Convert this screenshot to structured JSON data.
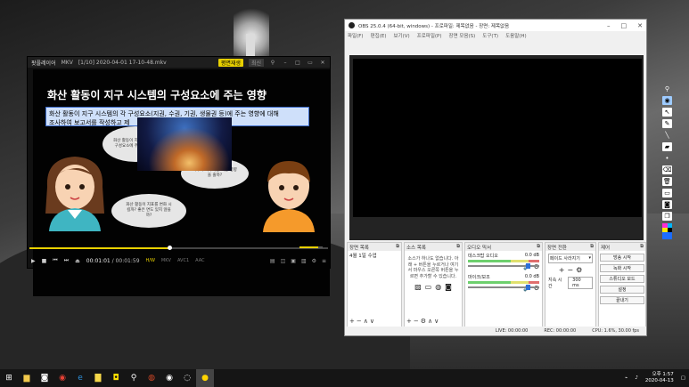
{
  "player": {
    "app_name": "팟플레이어",
    "format": "MKV",
    "file_title": "[1/10] 2020-04-01 17-10-48.mkv",
    "yellow_button": "평면재생",
    "grey_button": "최신",
    "slide_title": "화산 활동이 지구 시스템의 구성요소에 주는 영향",
    "slide_box_line1": "화산 활동이 지구 시스템의 각 구성요소(지권, 수권, 기권, 생물권 등)에 주는 영향에 대해",
    "slide_box_line2": "조사하여 보고서를 작성하고 제",
    "bubble1": "화산 활동이 지구 시스템의 구성요소에 주는 영향은?",
    "bubble2": "지구의 기후에는 어떤 영향을 줄까?",
    "bubble3": "화산 활동이 지표를 변화 시킬까? 좋은 면도 있지 않을까?",
    "time_current": "00:01:01",
    "time_total": "00:01:59",
    "tags": [
      "H/W",
      "MKV",
      "AVC1",
      "AAC"
    ],
    "seek_progress": 0.47,
    "volume": 0.8
  },
  "obs": {
    "title": "OBS 25.0.4 (64-bit, windows) - 프로파일: 제목없음 - 장면: 제목없음",
    "menu": [
      "파일(F)",
      "편집(E)",
      "보기(V)",
      "프로파일(P)",
      "장면 모음(S)",
      "도구(T)",
      "도움말(H)"
    ],
    "scenes_header": "장면 목록",
    "scene_item": "4월 1일 수업",
    "sources_header": "소스 목록",
    "sources_message": "소스가 하나도 없습니다. 아래 + 버튼을 누르거나 여기서 마우스 오른쪽 버튼을 누르면 추가할 수 있습니다.",
    "mixer_header": "오디오 믹서",
    "mixer_rows": [
      {
        "name": "데스크탑 오디오",
        "db": "0.0 dB"
      },
      {
        "name": "마이크/보조",
        "db": "0.0 dB"
      }
    ],
    "transitions_header": "장면 전환",
    "transition_type": "페이드 사라지기",
    "duration_label": "지속 시간",
    "duration_value": "300 ms",
    "controls_header": "제어",
    "controls": [
      "방송 시작",
      "녹화 시작",
      "스튜디오 모드",
      "설정",
      "끝내기"
    ],
    "status_live": "LIVE: 00:00:00",
    "status_rec": "REC: 00:00:00",
    "status_cpu": "CPU: 1.6%, 30.00 fps"
  },
  "taskbar": {
    "time": "오후 1:57",
    "date": "2020-04-13"
  },
  "colors": {
    "accent_yellow": "#e8d000",
    "slide_box_bg": "#cfe0fa",
    "obs_bg": "#f0f0f0"
  }
}
